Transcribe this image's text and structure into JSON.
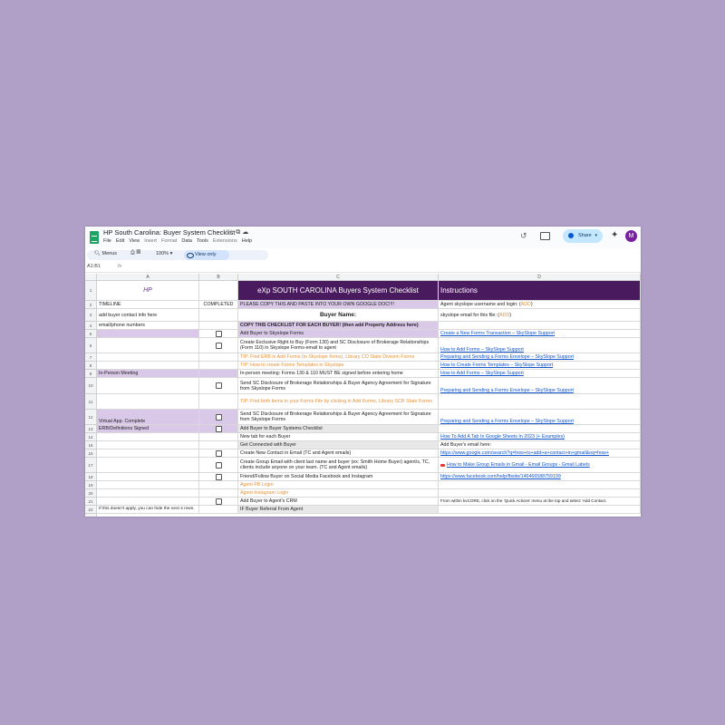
{
  "window": {
    "doc_title": "HP South Carolina: Buyer System Checklist",
    "menu": [
      "File",
      "Edit",
      "View",
      "Insert",
      "Format",
      "Data",
      "Tools",
      "Extensions",
      "Help"
    ],
    "share_label": "Share",
    "avatar_letter": "M"
  },
  "toolbar": {
    "menus_label": "Menus",
    "zoom": "100%",
    "view_only": "View only",
    "name_box": "A1:B1",
    "fx": "fx"
  },
  "columns": [
    "A",
    "B",
    "C",
    "D"
  ],
  "logo_text": "HP",
  "rows": [
    {
      "n": "1",
      "c": "eXp SOUTH CAROLINA Buyers System Checklist",
      "d": "Instructions"
    },
    {
      "n": "2",
      "a": "TIMELINE",
      "b": "COMPLETED",
      "c": "PLEASE COPY THIS AND PASTE INTO YOUR OWN GOOGLE DOC!!!!",
      "d_pre": "Agent skyslope username and login: (",
      "d_add": "ADD",
      "d_post": ")"
    },
    {
      "n": "3",
      "a": "add buyer contact info here",
      "c": "Buyer Name:",
      "d_pre": "skyslope email for this file: (",
      "d_add": "ADD",
      "d_post": ")"
    },
    {
      "n": "4",
      "a": "email/phone numbers",
      "c": "COPY THIS CHECKLIST FOR EACH BUYER! (then add Property Address here)"
    },
    {
      "n": "5",
      "c": "Add Buyer to Skyslope Forms",
      "d": "Create a New Forms Transaction – SkySlope Support"
    },
    {
      "n": "6",
      "c": "Create Exclusive Right to Buy (Form 130) and SC Disclosure of Brokerage Relationships (Form 110) in Skyslope Forms-email to agent",
      "d": "How to Add Forms – SkySlope Support"
    },
    {
      "n": "7",
      "c": "TIP: Find ERB in Add Forms (in Skyslope forms), Library CO State Division Forms",
      "d": "Preparing and Sending a Forms Envelope – SkySlope Support"
    },
    {
      "n": "8",
      "c": "TIP: How to create Forms Templates in Skyslope",
      "d": "How to Create Forms Templates – SkySlope Support"
    },
    {
      "n": "9",
      "a": "In-Person Meeting",
      "c": "In-person meeting:  Forms 130 & 110 MUST BE signed before entering home",
      "d": "How to Add Forms – SkySlope Support"
    },
    {
      "n": "10",
      "c": "Send SC Disclosure of Brokerage Relationships & Buyer Agency Agreement for Signature from Skyslope Forms",
      "d": "Preparing and Sending a Forms Envelope – SkySlope Support"
    },
    {
      "n": "11",
      "c": "TIP: Find both items in your Forms File by clicking in Add Forms, Library SCR State Forms"
    },
    {
      "n": "12",
      "a": "Virtual App. Complete",
      "c": "Send SC Disclosure of Brokerage Relationships & Buyer Agency Agreement for Signature from Skyslope Forms",
      "d": "Preparing and Sending a Forms Envelope – SkySlope Support"
    },
    {
      "n": "13",
      "a": "ERB/Definitions Signed",
      "c": "Add Buyer to Buyer Systems Checklist"
    },
    {
      "n": "14",
      "c": "New tab for each Buyer",
      "d": "How To Add A Tab In Google Sheets In 2023 (+ Examples)"
    },
    {
      "n": "15",
      "c": "Get Connected with Buyer",
      "d": "Add Buyer's email here:"
    },
    {
      "n": "16",
      "c": "Create New Contact in Email (TC and Agent emails)",
      "d": "https://www.google.com/search?q=how+to+add+a+contact+in+gmail&oq=how+"
    },
    {
      "n": "17",
      "c": "Create Group Email with client last name and buyer (ex: Smith Home Buyer) agent/s, TC, clients include anyone on your team. (TC and Agent emails)",
      "d": "How to Make Group Emails in Gmail - Email Groups - Gmail Labels"
    },
    {
      "n": "18",
      "c": "Friend/Follow Buyer on Social Media Facebook and Instagram",
      "d": "https://www.facebook.com/help/fbsite/146466588759199"
    },
    {
      "n": "19",
      "c": "Agent FB Login"
    },
    {
      "n": "20",
      "c": "Agent Instagram Login"
    },
    {
      "n": "21",
      "c": "Add Buyer to Agent's CRM",
      "d": "From within kvCORE, click on the 'Quick Actions' menu at the top and select 'Add Contact."
    },
    {
      "n": "22",
      "a": "If this doesn't apply, you can hide the next 4 rows.",
      "c": "IF Buyer Referral From Agent"
    }
  ]
}
